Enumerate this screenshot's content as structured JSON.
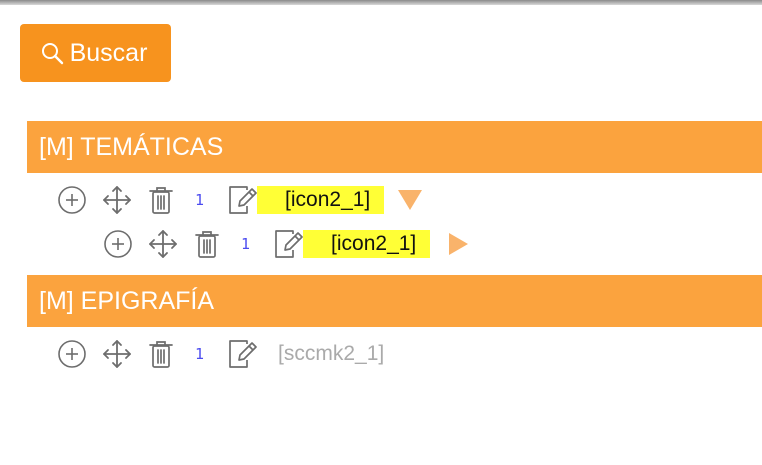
{
  "toolbar": {
    "search_label": "Buscar",
    "search_icon": "search-icon"
  },
  "sections": [
    {
      "title": "[M] TEMÁTICAS",
      "items": [
        {
          "count": "1",
          "label": "[icon2_1]",
          "highlight": true,
          "expander": "expanded",
          "indent": 0
        },
        {
          "count": "1",
          "label": "[icon2_1]",
          "highlight": true,
          "expander": "collapsed",
          "indent": 1
        }
      ]
    },
    {
      "title": "[M] EPIGRAFÍA",
      "items": [
        {
          "count": "1",
          "label": "[sccmk2_1]",
          "highlight": false,
          "expander": "none",
          "indent": 0
        }
      ]
    }
  ],
  "colors": {
    "button": "#f7931e",
    "section_header": "#fba33e",
    "highlight": "#ffff36",
    "expander": "#f9b36b",
    "count": "#4c4cf0",
    "icon": "#6d6d6d"
  }
}
